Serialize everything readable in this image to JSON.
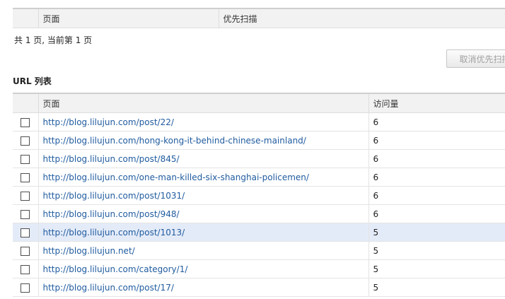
{
  "top_table": {
    "columns": [
      "页面",
      "优先扫描"
    ]
  },
  "pagination": {
    "text": "共 1 页, 当前第 1 页"
  },
  "cancel_button": {
    "label": "取消优先扫描"
  },
  "url_list": {
    "title": "URL 列表",
    "columns": [
      "页面",
      "访问量"
    ],
    "rows": [
      {
        "url": "http://blog.lilujun.com/post/22/",
        "visits": "6"
      },
      {
        "url": "http://blog.lilujun.com/hong-kong-it-behind-chinese-mainland/",
        "visits": "6"
      },
      {
        "url": "http://blog.lilujun.com/post/845/",
        "visits": "6"
      },
      {
        "url": "http://blog.lilujun.com/one-man-killed-six-shanghai-policemen/",
        "visits": "6"
      },
      {
        "url": "http://blog.lilujun.com/post/1031/",
        "visits": "6"
      },
      {
        "url": "http://blog.lilujun.com/post/948/",
        "visits": "6"
      },
      {
        "url": "http://blog.lilujun.com/post/1013/",
        "visits": "5",
        "highlighted": true
      },
      {
        "url": "http://blog.lilujun.net/",
        "visits": "5"
      },
      {
        "url": "http://blog.lilujun.com/category/1/",
        "visits": "5"
      },
      {
        "url": "http://blog.lilujun.com/post/17/",
        "visits": "5"
      }
    ]
  },
  "colors": {
    "link": "#1f5b9f",
    "highlight_row": "#e4ebf8",
    "header_bg": "#f2f2f2"
  }
}
